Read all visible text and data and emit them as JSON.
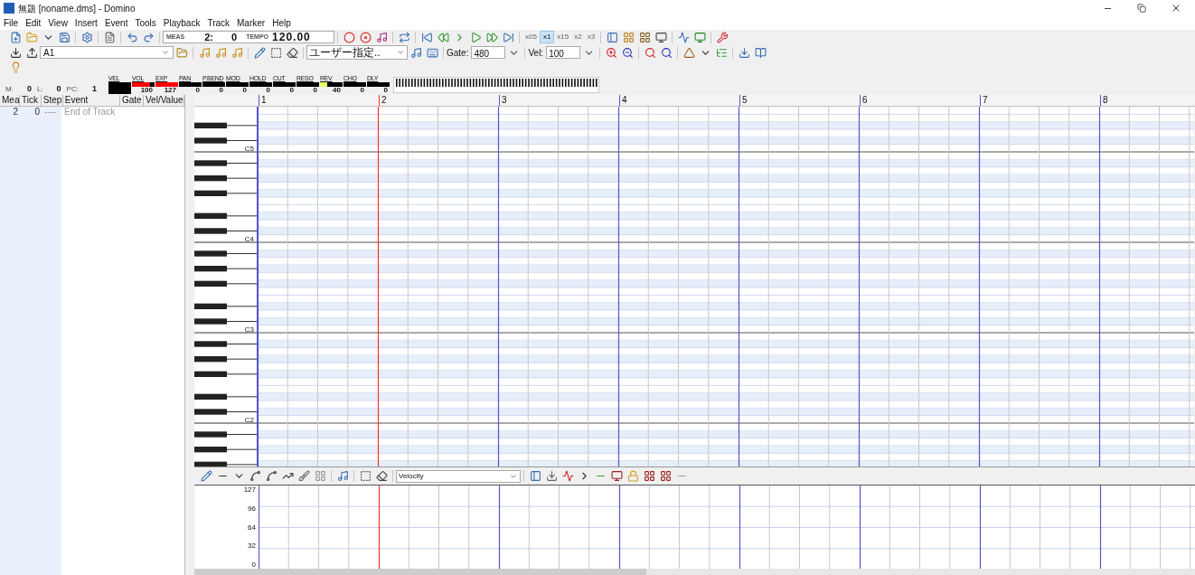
{
  "window": {
    "title": "無題 [noname.dms] - Domino"
  },
  "menu": [
    "File",
    "Edit",
    "View",
    "Insert",
    "Event",
    "Tools",
    "Playback",
    "Track",
    "Marker",
    "Help"
  ],
  "transport": {
    "meas_label": "MEAS",
    "meas": "2:",
    "tick": "0",
    "tempo_label": "TEMPO",
    "tempo": "120.00"
  },
  "speeds": [
    {
      "label": "x05",
      "selected": false
    },
    {
      "label": "x1",
      "selected": true
    },
    {
      "label": "x15",
      "selected": false
    },
    {
      "label": "x2",
      "selected": false
    },
    {
      "label": "x3",
      "selected": false
    }
  ],
  "track_bar": {
    "track": "A1",
    "tool_preset": "ユーザー指定..",
    "gate_label": "Gate:",
    "gate": "480",
    "vel_label": "Vel:",
    "vel": "100"
  },
  "mixer": {
    "fields": [
      {
        "label": "M:",
        "value": "0"
      },
      {
        "label": "L:",
        "value": "0"
      },
      {
        "label": "PC:",
        "value": "1"
      }
    ],
    "controllers": [
      {
        "name": "VEL"
      },
      {
        "name": "VOL",
        "value": "100",
        "level": 0.79,
        "color": "#ff0000"
      },
      {
        "name": "EXP",
        "value": "127",
        "level": 1,
        "color": "#ff0000"
      },
      {
        "name": "PAN",
        "value": "0"
      },
      {
        "name": "P.BEND",
        "value": "0"
      },
      {
        "name": "MOD",
        "value": "0"
      },
      {
        "name": "HOLD",
        "value": "0"
      },
      {
        "name": "CUT",
        "value": "0"
      },
      {
        "name": "RESO",
        "value": "0"
      },
      {
        "name": "REV",
        "value": "40",
        "level": 0.32,
        "color": "#e6ff66"
      },
      {
        "name": "CHO",
        "value": "0"
      },
      {
        "name": "DLY",
        "value": "0"
      }
    ]
  },
  "event_list": {
    "columns": [
      "Mea",
      "Tick",
      "Step",
      "Event",
      "Gate",
      "Vel/Value"
    ],
    "rows": [
      {
        "mea": "2",
        "tick": "0",
        "step": "----",
        "event": "End of Track"
      }
    ]
  },
  "piano_roll": {
    "measures": [
      {
        "label": "1",
        "playhead": false
      },
      {
        "label": "2",
        "playhead": true
      },
      {
        "label": "3",
        "playhead": false
      },
      {
        "label": "4",
        "playhead": false
      },
      {
        "label": "5",
        "playhead": false
      },
      {
        "label": "6",
        "playhead": false
      },
      {
        "label": "7",
        "playhead": false
      },
      {
        "label": "8",
        "playhead": false
      }
    ],
    "note_labels": [
      "C5",
      "C4",
      "C3",
      "C2"
    ]
  },
  "velocity_pane": {
    "controller": "Velocity",
    "scale": [
      "127",
      "96",
      "64",
      "32",
      "0"
    ]
  }
}
